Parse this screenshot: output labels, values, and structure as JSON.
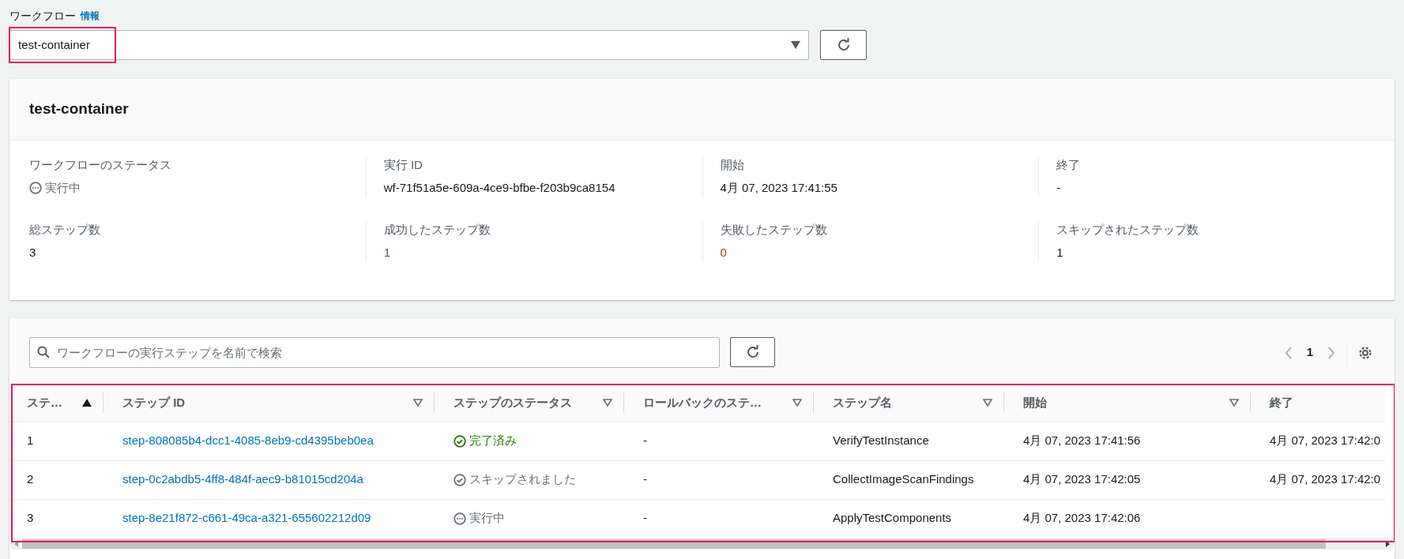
{
  "workflow_select": {
    "label": "ワークフロー",
    "info_link": "情報",
    "value": "test-container",
    "highlighted": true
  },
  "summary": {
    "title": "test-container",
    "fields": [
      {
        "label": "ワークフローのステータス",
        "value": "実行中",
        "kind": "status",
        "color": "#687078"
      },
      {
        "label": "実行 ID",
        "value": "wf-71f51a5e-609a-4ce9-bfbe-f203b9ca8154",
        "kind": "text",
        "color": "#16191f"
      },
      {
        "label": "開始",
        "value": "4月 07, 2023 17:41:55",
        "kind": "text",
        "color": "#16191f"
      },
      {
        "label": "終了",
        "value": "-",
        "kind": "text",
        "color": "#16191f"
      },
      {
        "label": "総ステップ数",
        "value": "3",
        "kind": "text",
        "color": "#16191f"
      },
      {
        "label": "成功したステップ数",
        "value": "1",
        "kind": "text",
        "color": "#1d8102"
      },
      {
        "label": "失敗したステップ数",
        "value": "0",
        "kind": "text",
        "color": "#d13212"
      },
      {
        "label": "スキップされたステップ数",
        "value": "1",
        "kind": "text",
        "color": "#16191f"
      }
    ]
  },
  "steps": {
    "search": {
      "placeholder": "ワークフローの実行ステップを名前で検索"
    },
    "pagination": {
      "current_page": "1"
    },
    "highlighted": true,
    "table": {
      "columns": [
        {
          "label": "ステ…",
          "sorted": true
        },
        {
          "label": "ステップ ID",
          "sorted": false
        },
        {
          "label": "ステップのステータス",
          "sorted": false
        },
        {
          "label": "ロールバックのステ…",
          "sorted": false
        },
        {
          "label": "ステップ名",
          "sorted": false
        },
        {
          "label": "開始",
          "sorted": false
        },
        {
          "label": "終了"
        }
      ],
      "rows": [
        {
          "number": "1",
          "step_id": "step-808085b4-dcc1-4085-8eb9-cd4395beb0ea",
          "status": {
            "kind": "success",
            "text": "完了済み"
          },
          "rollback": "-",
          "name": "VerifyTestInstance",
          "start": "4月 07, 2023 17:41:56",
          "end": "4月 07, 2023 17:42:0"
        },
        {
          "number": "2",
          "step_id": "step-0c2abdb5-4ff8-484f-aec9-b81015cd204a",
          "status": {
            "kind": "skipped",
            "text": "スキップされました"
          },
          "rollback": "-",
          "name": "CollectImageScanFindings",
          "start": "4月 07, 2023 17:42:05",
          "end": "4月 07, 2023 17:42:0"
        },
        {
          "number": "3",
          "step_id": "step-8e21f872-c661-49ca-a321-655602212d09",
          "status": {
            "kind": "running",
            "text": "実行中"
          },
          "rollback": "-",
          "name": "ApplyTestComponents",
          "start": "4月 07, 2023 17:42:06"
        }
      ]
    }
  }
}
